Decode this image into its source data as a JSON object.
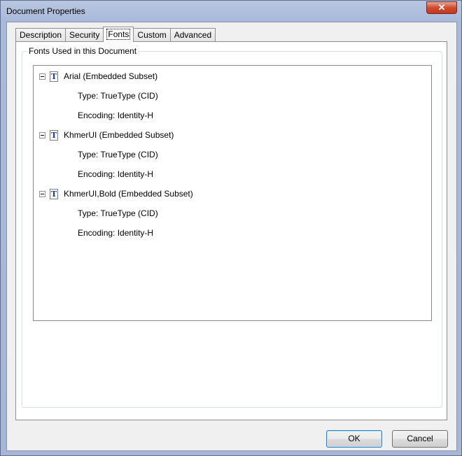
{
  "window": {
    "title": "Document Properties",
    "close_label": "✕"
  },
  "tabs": [
    "Description",
    "Security",
    "Fonts",
    "Custom",
    "Advanced"
  ],
  "active_tab": "Fonts",
  "group": {
    "label": "Fonts Used in this Document"
  },
  "fonts": [
    {
      "name": "Arial (Embedded Subset)",
      "type": "Type: TrueType (CID)",
      "encoding": "Encoding: Identity-H"
    },
    {
      "name": "KhmerUI (Embedded Subset)",
      "type": "Type: TrueType (CID)",
      "encoding": "Encoding: Identity-H"
    },
    {
      "name": "KhmerUI,Bold (Embedded Subset)",
      "type": "Type: TrueType (CID)",
      "encoding": "Encoding: Identity-H"
    }
  ],
  "buttons": {
    "ok": "OK",
    "cancel": "Cancel"
  }
}
